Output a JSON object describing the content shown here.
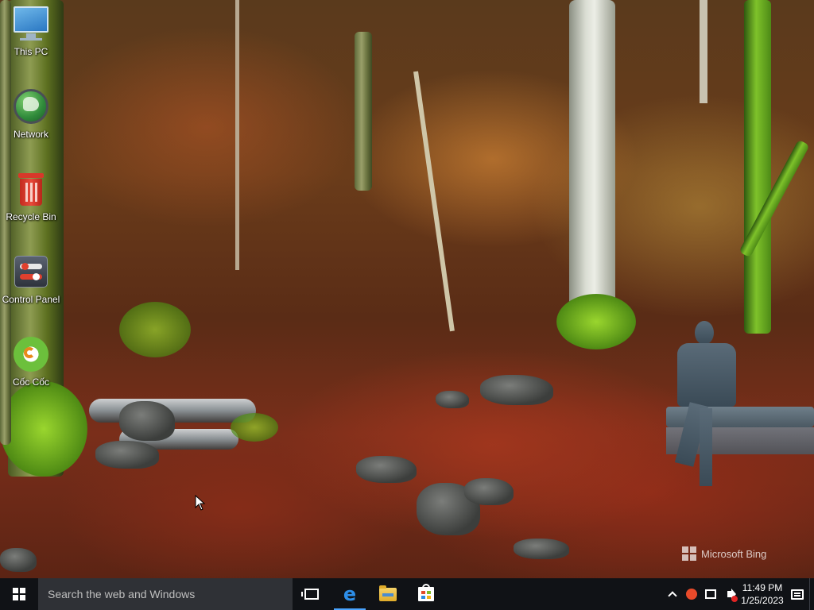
{
  "desktop": {
    "icons": [
      {
        "label": "This PC",
        "icon": "monitor-icon"
      },
      {
        "label": "Network",
        "icon": "globe-icon"
      },
      {
        "label": "Recycle Bin",
        "icon": "recycle-bin-icon"
      },
      {
        "label": "Control Panel",
        "icon": "control-panel-icon"
      },
      {
        "label": "Cốc Cốc",
        "icon": "coccoc-browser-icon"
      }
    ],
    "watermark": "Microsoft Bing"
  },
  "taskbar": {
    "start_icon": "windows-logo-icon",
    "search_placeholder": "Search the web and Windows",
    "pinned": [
      {
        "name": "Task View",
        "icon": "task-view-icon"
      },
      {
        "name": "Microsoft Edge",
        "icon": "edge-icon",
        "active": true
      },
      {
        "name": "File Explorer",
        "icon": "folder-icon"
      },
      {
        "name": "Store",
        "icon": "store-icon"
      }
    ],
    "tray": {
      "icons": [
        "chevron-up-icon",
        "coccoc-tray-icon",
        "network-icon",
        "volume-muted-icon"
      ],
      "time": "11:49 PM",
      "date": "1/25/2023",
      "notification_icon": "action-center-icon"
    }
  },
  "colors": {
    "taskbar_bg": "#101216",
    "search_bg": "#2f3136",
    "accent": "#4aa4ff"
  }
}
